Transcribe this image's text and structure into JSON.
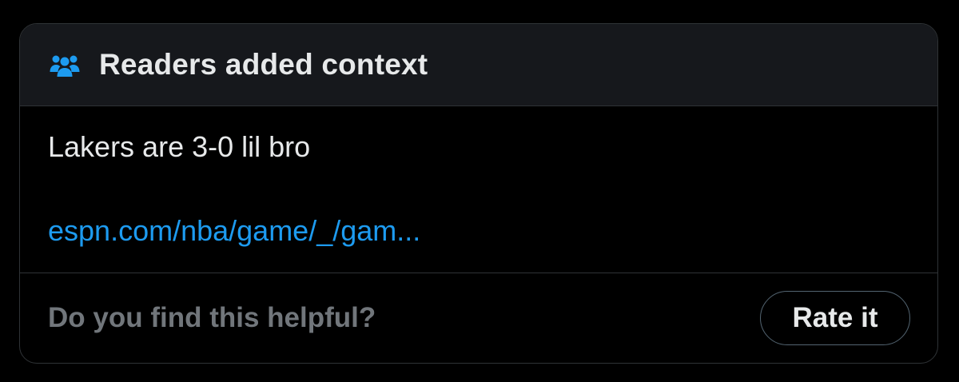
{
  "note": {
    "header": {
      "icon": "people-icon",
      "title": "Readers added context",
      "accent_color": "#1d9bf0"
    },
    "body": {
      "text": "Lakers are 3-0 lil bro",
      "link_text": "espn.com/nba/game/_/gam..."
    },
    "footer": {
      "question": "Do you find this helpful?",
      "rate_button_label": "Rate it"
    }
  }
}
